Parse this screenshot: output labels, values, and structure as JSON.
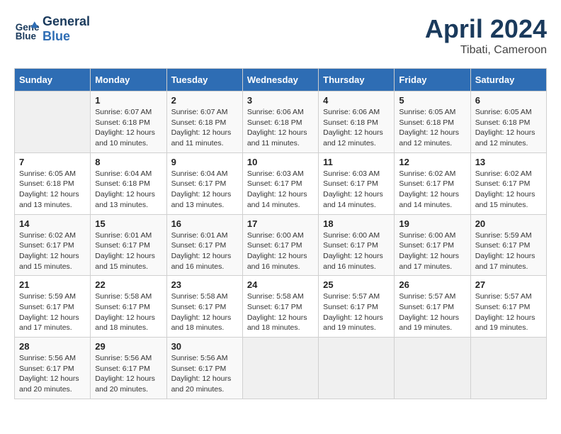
{
  "header": {
    "logo_line1": "General",
    "logo_line2": "Blue",
    "month_title": "April 2024",
    "location": "Tibati, Cameroon"
  },
  "weekdays": [
    "Sunday",
    "Monday",
    "Tuesday",
    "Wednesday",
    "Thursday",
    "Friday",
    "Saturday"
  ],
  "weeks": [
    [
      {
        "day": "",
        "empty": true
      },
      {
        "day": "1",
        "sunrise": "6:07 AM",
        "sunset": "6:18 PM",
        "daylight": "12 hours and 10 minutes."
      },
      {
        "day": "2",
        "sunrise": "6:07 AM",
        "sunset": "6:18 PM",
        "daylight": "12 hours and 11 minutes."
      },
      {
        "day": "3",
        "sunrise": "6:06 AM",
        "sunset": "6:18 PM",
        "daylight": "12 hours and 11 minutes."
      },
      {
        "day": "4",
        "sunrise": "6:06 AM",
        "sunset": "6:18 PM",
        "daylight": "12 hours and 12 minutes."
      },
      {
        "day": "5",
        "sunrise": "6:05 AM",
        "sunset": "6:18 PM",
        "daylight": "12 hours and 12 minutes."
      },
      {
        "day": "6",
        "sunrise": "6:05 AM",
        "sunset": "6:18 PM",
        "daylight": "12 hours and 12 minutes."
      }
    ],
    [
      {
        "day": "7",
        "sunrise": "6:05 AM",
        "sunset": "6:18 PM",
        "daylight": "12 hours and 13 minutes."
      },
      {
        "day": "8",
        "sunrise": "6:04 AM",
        "sunset": "6:18 PM",
        "daylight": "12 hours and 13 minutes."
      },
      {
        "day": "9",
        "sunrise": "6:04 AM",
        "sunset": "6:17 PM",
        "daylight": "12 hours and 13 minutes."
      },
      {
        "day": "10",
        "sunrise": "6:03 AM",
        "sunset": "6:17 PM",
        "daylight": "12 hours and 14 minutes."
      },
      {
        "day": "11",
        "sunrise": "6:03 AM",
        "sunset": "6:17 PM",
        "daylight": "12 hours and 14 minutes."
      },
      {
        "day": "12",
        "sunrise": "6:02 AM",
        "sunset": "6:17 PM",
        "daylight": "12 hours and 14 minutes."
      },
      {
        "day": "13",
        "sunrise": "6:02 AM",
        "sunset": "6:17 PM",
        "daylight": "12 hours and 15 minutes."
      }
    ],
    [
      {
        "day": "14",
        "sunrise": "6:02 AM",
        "sunset": "6:17 PM",
        "daylight": "12 hours and 15 minutes."
      },
      {
        "day": "15",
        "sunrise": "6:01 AM",
        "sunset": "6:17 PM",
        "daylight": "12 hours and 15 minutes."
      },
      {
        "day": "16",
        "sunrise": "6:01 AM",
        "sunset": "6:17 PM",
        "daylight": "12 hours and 16 minutes."
      },
      {
        "day": "17",
        "sunrise": "6:00 AM",
        "sunset": "6:17 PM",
        "daylight": "12 hours and 16 minutes."
      },
      {
        "day": "18",
        "sunrise": "6:00 AM",
        "sunset": "6:17 PM",
        "daylight": "12 hours and 16 minutes."
      },
      {
        "day": "19",
        "sunrise": "6:00 AM",
        "sunset": "6:17 PM",
        "daylight": "12 hours and 17 minutes."
      },
      {
        "day": "20",
        "sunrise": "5:59 AM",
        "sunset": "6:17 PM",
        "daylight": "12 hours and 17 minutes."
      }
    ],
    [
      {
        "day": "21",
        "sunrise": "5:59 AM",
        "sunset": "6:17 PM",
        "daylight": "12 hours and 17 minutes."
      },
      {
        "day": "22",
        "sunrise": "5:58 AM",
        "sunset": "6:17 PM",
        "daylight": "12 hours and 18 minutes."
      },
      {
        "day": "23",
        "sunrise": "5:58 AM",
        "sunset": "6:17 PM",
        "daylight": "12 hours and 18 minutes."
      },
      {
        "day": "24",
        "sunrise": "5:58 AM",
        "sunset": "6:17 PM",
        "daylight": "12 hours and 18 minutes."
      },
      {
        "day": "25",
        "sunrise": "5:57 AM",
        "sunset": "6:17 PM",
        "daylight": "12 hours and 19 minutes."
      },
      {
        "day": "26",
        "sunrise": "5:57 AM",
        "sunset": "6:17 PM",
        "daylight": "12 hours and 19 minutes."
      },
      {
        "day": "27",
        "sunrise": "5:57 AM",
        "sunset": "6:17 PM",
        "daylight": "12 hours and 19 minutes."
      }
    ],
    [
      {
        "day": "28",
        "sunrise": "5:56 AM",
        "sunset": "6:17 PM",
        "daylight": "12 hours and 20 minutes."
      },
      {
        "day": "29",
        "sunrise": "5:56 AM",
        "sunset": "6:17 PM",
        "daylight": "12 hours and 20 minutes."
      },
      {
        "day": "30",
        "sunrise": "5:56 AM",
        "sunset": "6:17 PM",
        "daylight": "12 hours and 20 minutes."
      },
      {
        "day": "",
        "empty": true
      },
      {
        "day": "",
        "empty": true
      },
      {
        "day": "",
        "empty": true
      },
      {
        "day": "",
        "empty": true
      }
    ]
  ]
}
